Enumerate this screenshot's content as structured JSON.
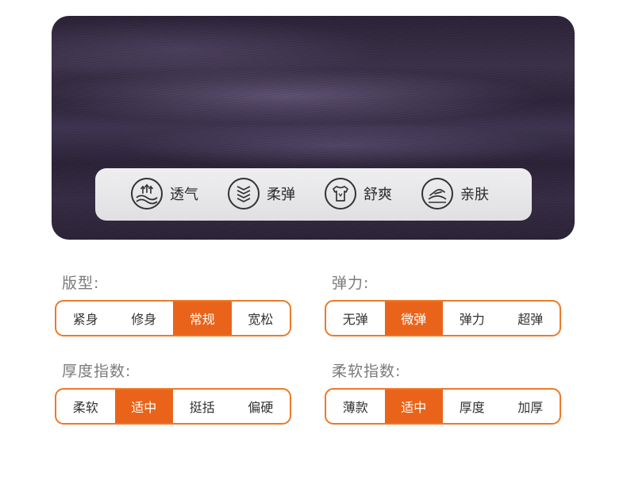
{
  "features": [
    {
      "label": "透气",
      "icon": "breathable-icon"
    },
    {
      "label": "柔弹",
      "icon": "elastic-waves-icon"
    },
    {
      "label": "舒爽",
      "icon": "tshirt-icon"
    },
    {
      "label": "亲肤",
      "icon": "hand-skin-icon"
    }
  ],
  "specs": {
    "fit": {
      "title": "版型:",
      "options": [
        "紧身",
        "修身",
        "常规",
        "宽松"
      ],
      "selected": "常规"
    },
    "elasticity": {
      "title": "弹力:",
      "options": [
        "无弹",
        "微弹",
        "弹力",
        "超弹"
      ],
      "selected": "微弹"
    },
    "thickness": {
      "title": "厚度指数:",
      "options": [
        "柔软",
        "适中",
        "挺括",
        "偏硬"
      ],
      "selected": "适中"
    },
    "softness": {
      "title": "柔软指数:",
      "options": [
        "薄款",
        "适中",
        "厚度",
        "加厚"
      ],
      "selected": "适中"
    }
  },
  "colors": {
    "accent": "#e9641a",
    "border": "#ec7a2a",
    "fabric": "#2f2640"
  }
}
